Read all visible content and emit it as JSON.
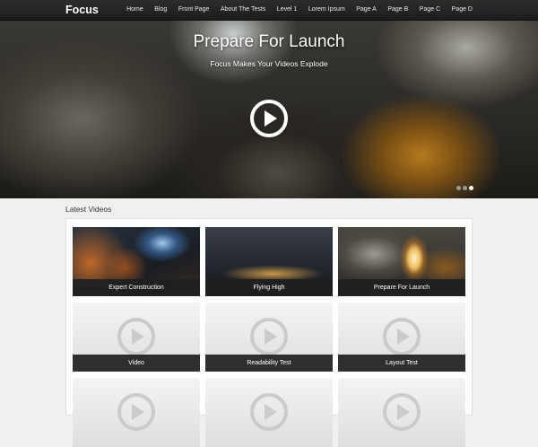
{
  "header": {
    "logo": "Focus",
    "nav": [
      {
        "label": "Home"
      },
      {
        "label": "Blog"
      },
      {
        "label": "Front Page"
      },
      {
        "label": "About The Tests"
      },
      {
        "label": "Level 1"
      },
      {
        "label": "Lorem Ipsum"
      },
      {
        "label": "Page A"
      },
      {
        "label": "Page B"
      },
      {
        "label": "Page C"
      },
      {
        "label": "Page D"
      }
    ]
  },
  "hero": {
    "title": "Prepare For Launch",
    "subtitle": "Focus Makes Your Videos Explode",
    "play_icon": "play-circle-icon",
    "slides": 3,
    "active_slide": 3
  },
  "latest": {
    "title": "Latest Videos",
    "videos": [
      {
        "caption": "Expert Construction",
        "thumbnail": "welding-photo"
      },
      {
        "caption": "Flying High",
        "thumbnail": "city-night-photo"
      },
      {
        "caption": "Prepare For Launch",
        "thumbnail": "rocket-launch-photo"
      },
      {
        "caption": "Video",
        "thumbnail": "placeholder-play-icon"
      },
      {
        "caption": "Readability Test",
        "thumbnail": "placeholder-play-icon"
      },
      {
        "caption": "Layout Test",
        "thumbnail": "placeholder-play-icon"
      },
      {
        "caption": "",
        "thumbnail": "placeholder-play-icon"
      },
      {
        "caption": "",
        "thumbnail": "placeholder-play-icon"
      },
      {
        "caption": "",
        "thumbnail": "placeholder-play-icon"
      }
    ]
  },
  "colors": {
    "header_bg": "#1f2022",
    "page_bg": "#f1f0ee",
    "caption_bg": "#1e1f21",
    "text_light": "#ffffff"
  }
}
